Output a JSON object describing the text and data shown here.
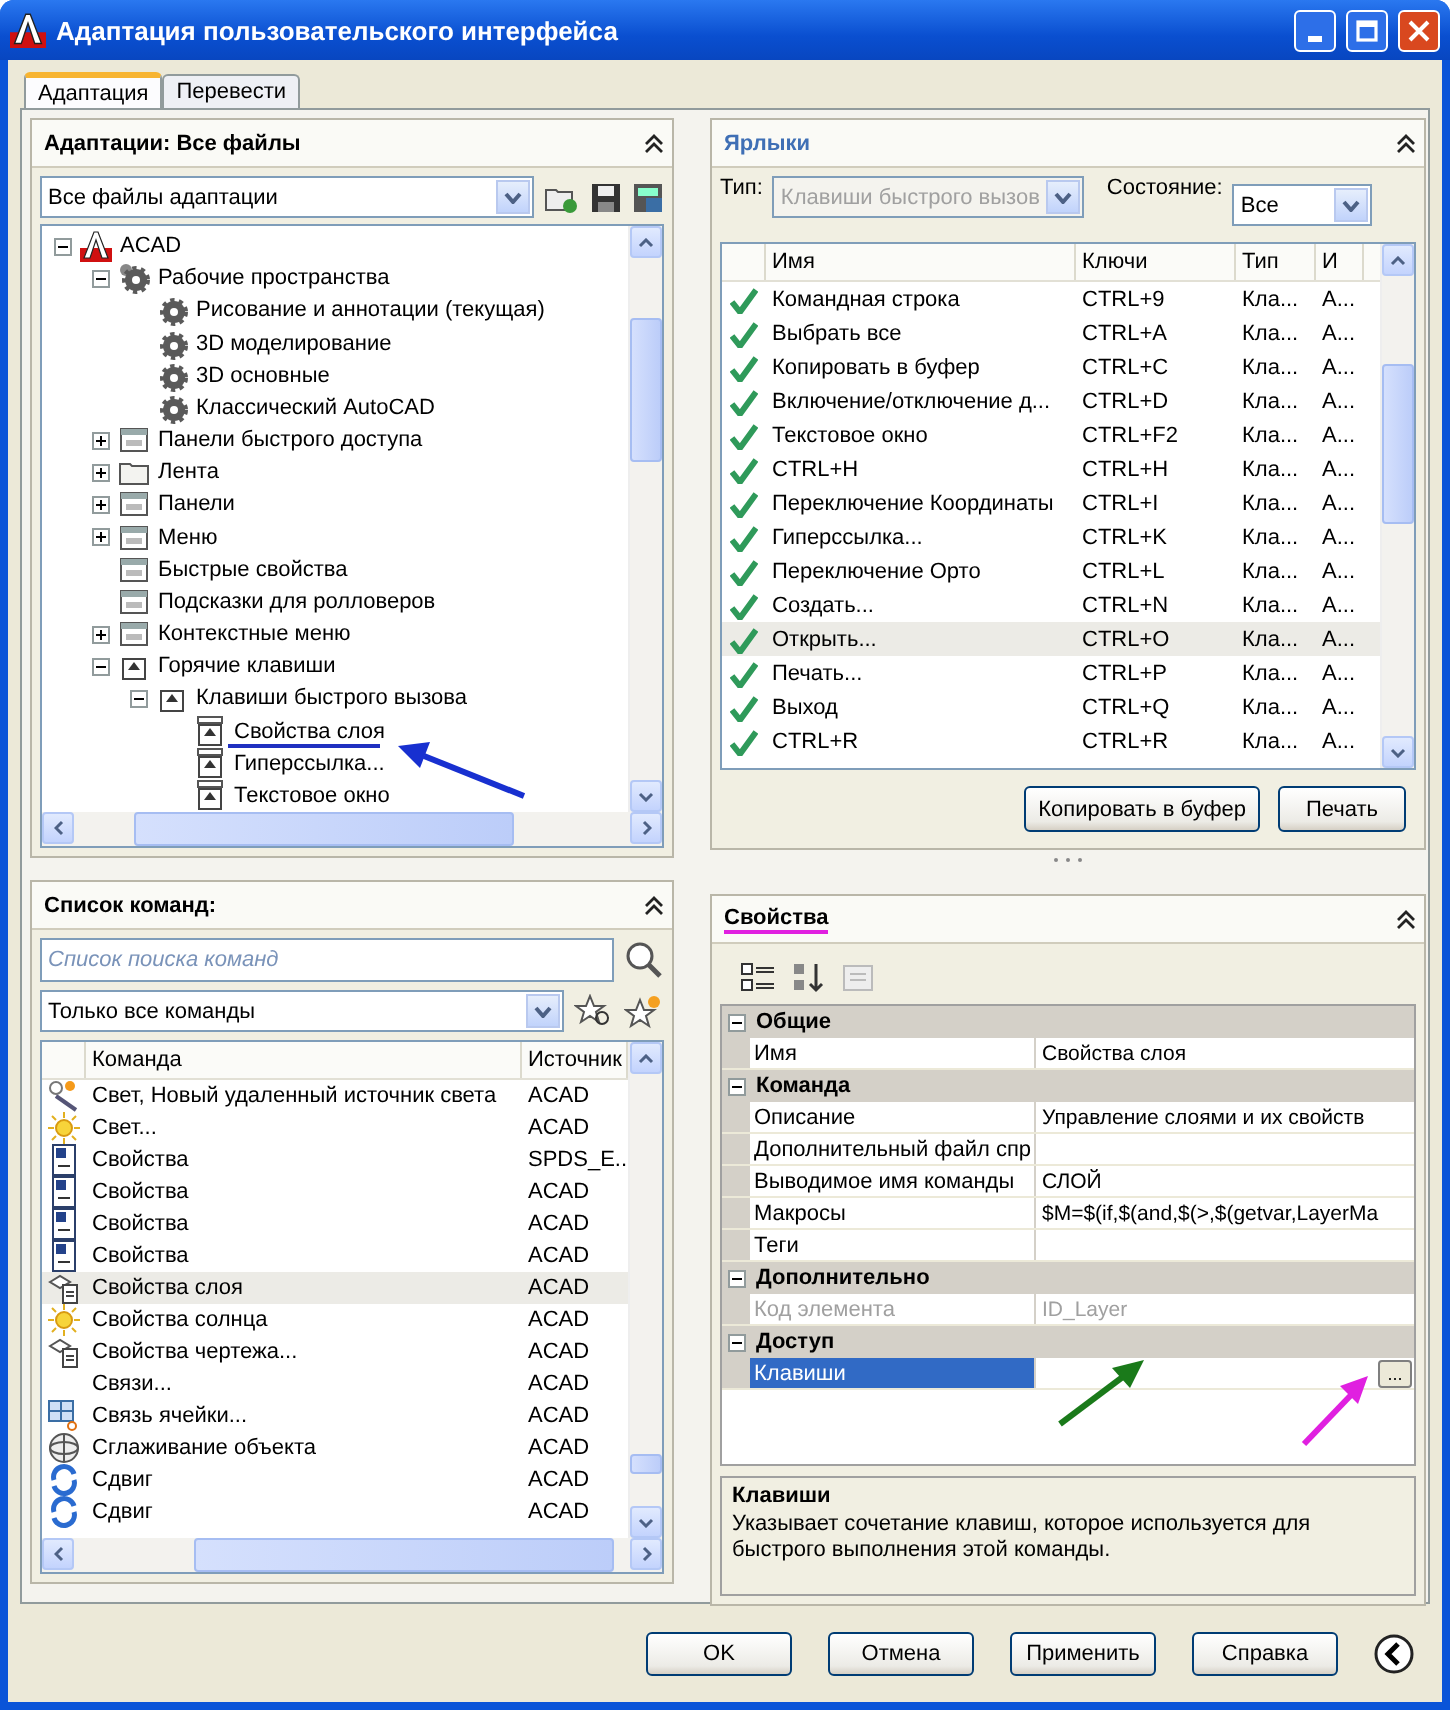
{
  "window": {
    "title": "Адаптация пользовательского интерфейса"
  },
  "tabs": [
    {
      "label": "Адаптация",
      "selected": true
    },
    {
      "label": "Перевести",
      "selected": false
    }
  ],
  "customizations": {
    "title": "Адаптации: Все файлы",
    "file_filter": "Все файлы адаптации",
    "tree": [
      {
        "label": "ACAD",
        "kind": "root",
        "expanded": true,
        "children": [
          {
            "label": "Рабочие пространства",
            "kind": "workspaces",
            "expanded": true,
            "children": [
              {
                "label": "Рисование и аннотации (текущая)",
                "kind": "workspace"
              },
              {
                "label": "3D моделирование",
                "kind": "workspace"
              },
              {
                "label": "3D основные",
                "kind": "workspace"
              },
              {
                "label": "Классический AutoCAD",
                "kind": "workspace"
              }
            ]
          },
          {
            "label": "Панели быстрого доступа",
            "kind": "toolbar",
            "expanded": false
          },
          {
            "label": "Лента",
            "kind": "folder",
            "expanded": false
          },
          {
            "label": "Панели",
            "kind": "toolbar",
            "expanded": false
          },
          {
            "label": "Меню",
            "kind": "menu",
            "expanded": false
          },
          {
            "label": "Быстрые свойства",
            "kind": "item"
          },
          {
            "label": "Подсказки для ролловеров",
            "kind": "item"
          },
          {
            "label": "Контекстные меню",
            "kind": "menu",
            "expanded": false
          },
          {
            "label": "Горячие клавиши",
            "kind": "keys",
            "expanded": true,
            "children": [
              {
                "label": "Клавиши быстрого вызова",
                "kind": "keys",
                "expanded": true,
                "children": [
                  {
                    "label": "Свойства слоя",
                    "kind": "shortcut"
                  },
                  {
                    "label": "Гиперссылка...",
                    "kind": "shortcut"
                  },
                  {
                    "label": "Текстовое окно",
                    "kind": "shortcut"
                  }
                ]
              }
            ]
          }
        ]
      }
    ]
  },
  "command_list": {
    "title": "Список команд:",
    "search_placeholder": "Список поиска команд",
    "filter": "Только все команды",
    "columns": [
      "Команда",
      "Источник"
    ],
    "rows": [
      {
        "command": "Свет, Новый удаленный источник света",
        "source": "ACAD",
        "kind": "light",
        "selected": false
      },
      {
        "command": "Свет...",
        "source": "ACAD",
        "kind": "sun",
        "selected": false
      },
      {
        "command": "Свойства",
        "source": "SPDS_E...",
        "kind": "panel",
        "selected": false
      },
      {
        "command": "Свойства",
        "source": "ACAD",
        "kind": "panel",
        "selected": false
      },
      {
        "command": "Свойства",
        "source": "ACAD",
        "kind": "panel",
        "selected": false
      },
      {
        "command": "Свойства",
        "source": "ACAD",
        "kind": "panel",
        "selected": false
      },
      {
        "command": "Свойства слоя",
        "source": "ACAD",
        "kind": "layer",
        "selected": true
      },
      {
        "command": "Свойства солнца",
        "source": "ACAD",
        "kind": "sun",
        "selected": false
      },
      {
        "command": "Свойства чертежа...",
        "source": "ACAD",
        "kind": "layer",
        "selected": false
      },
      {
        "command": "Связи...",
        "source": "ACAD",
        "kind": "none",
        "selected": false
      },
      {
        "command": "Связь ячейки...",
        "source": "ACAD",
        "kind": "grid",
        "selected": false
      },
      {
        "command": "Сглаживание объекта",
        "source": "ACAD",
        "kind": "sphere",
        "selected": false
      },
      {
        "command": "Сдвиг",
        "source": "ACAD",
        "kind": "shift",
        "selected": false
      },
      {
        "command": "Сдвиг",
        "source": "ACAD",
        "kind": "shift",
        "selected": false
      }
    ]
  },
  "shortcuts": {
    "title": "Ярлыки",
    "type_label": "Тип:",
    "type_value": "Клавиши быстрого вызов",
    "state_label": "Состояние:",
    "state_value": "Все",
    "columns": [
      "Имя",
      "Ключи",
      "Тип",
      "И"
    ],
    "rows": [
      {
        "name": "Командная строка",
        "keys": "CTRL+9",
        "type": "Кла...",
        "col_4": "А...",
        "selected": false
      },
      {
        "name": "Выбрать все",
        "keys": "CTRL+A",
        "type": "Кла...",
        "col_4": "А...",
        "selected": false
      },
      {
        "name": "Копировать в буфер",
        "keys": "CTRL+C",
        "type": "Кла...",
        "col_4": "А...",
        "selected": false
      },
      {
        "name": "Включение/отключение д...",
        "keys": "CTRL+D",
        "type": "Кла...",
        "col_4": "А...",
        "selected": false
      },
      {
        "name": "Текстовое окно",
        "keys": "CTRL+F2",
        "type": "Кла...",
        "col_4": "А...",
        "selected": false
      },
      {
        "name": "CTRL+H",
        "keys": "CTRL+H",
        "type": "Кла...",
        "col_4": "А...",
        "selected": false
      },
      {
        "name": "Переключение Координаты",
        "keys": "CTRL+I",
        "type": "Кла...",
        "col_4": "А...",
        "selected": false
      },
      {
        "name": "Гиперссылка...",
        "keys": "CTRL+K",
        "type": "Кла...",
        "col_4": "А...",
        "selected": false
      },
      {
        "name": "Переключение Орто",
        "keys": "CTRL+L",
        "type": "Кла...",
        "col_4": "А...",
        "selected": false
      },
      {
        "name": "Создать...",
        "keys": "CTRL+N",
        "type": "Кла...",
        "col_4": "А...",
        "selected": false
      },
      {
        "name": "Открыть...",
        "keys": "CTRL+O",
        "type": "Кла...",
        "col_4": "А...",
        "selected": true
      },
      {
        "name": "Печать...",
        "keys": "CTRL+P",
        "type": "Кла...",
        "col_4": "А...",
        "selected": false
      },
      {
        "name": "Выход",
        "keys": "CTRL+Q",
        "type": "Кла...",
        "col_4": "А...",
        "selected": false
      },
      {
        "name": "CTRL+R",
        "keys": "CTRL+R",
        "type": "Кла...",
        "col_4": "А...",
        "selected": false
      }
    ],
    "buttons": [
      "Копировать в буфер",
      "Печать"
    ]
  },
  "properties": {
    "title": "Свойства",
    "categories": [
      {
        "name": "Общие",
        "expanded": true,
        "rows": [
          {
            "name": "Имя",
            "value": "Свойства слоя",
            "disabled": false,
            "selected": false
          }
        ]
      },
      {
        "name": "Команда",
        "expanded": true,
        "rows": [
          {
            "name": "Описание",
            "value": "Управление слоями и их свойств",
            "disabled": false,
            "selected": false
          },
          {
            "name": "Дополнительный файл спр",
            "value": "",
            "disabled": false,
            "selected": false
          },
          {
            "name": "Выводимое имя команды",
            "value": "СЛОЙ",
            "disabled": false,
            "selected": false
          },
          {
            "name": "Макросы",
            "value": "$M=$(if,$(and,$(>,$(getvar,LayerMa",
            "disabled": false,
            "selected": false
          },
          {
            "name": "Теги",
            "value": "",
            "disabled": false,
            "selected": false
          }
        ]
      },
      {
        "name": "Дополнительно",
        "expanded": true,
        "rows": [
          {
            "name": "Код элемента",
            "value": "ID_Layer",
            "disabled": true,
            "selected": false
          }
        ]
      },
      {
        "name": "Доступ",
        "expanded": true,
        "rows": [
          {
            "name": "Клавиши",
            "value": "",
            "disabled": false,
            "selected": true,
            "browse": "..."
          }
        ]
      }
    ],
    "help": {
      "title": "Клавиши",
      "text": "Указывает сочетание клавиш, которое используется для быстрого выполнения этой команды."
    }
  },
  "buttons": [
    "OK",
    "Отмена",
    "Применить",
    "Справка"
  ]
}
